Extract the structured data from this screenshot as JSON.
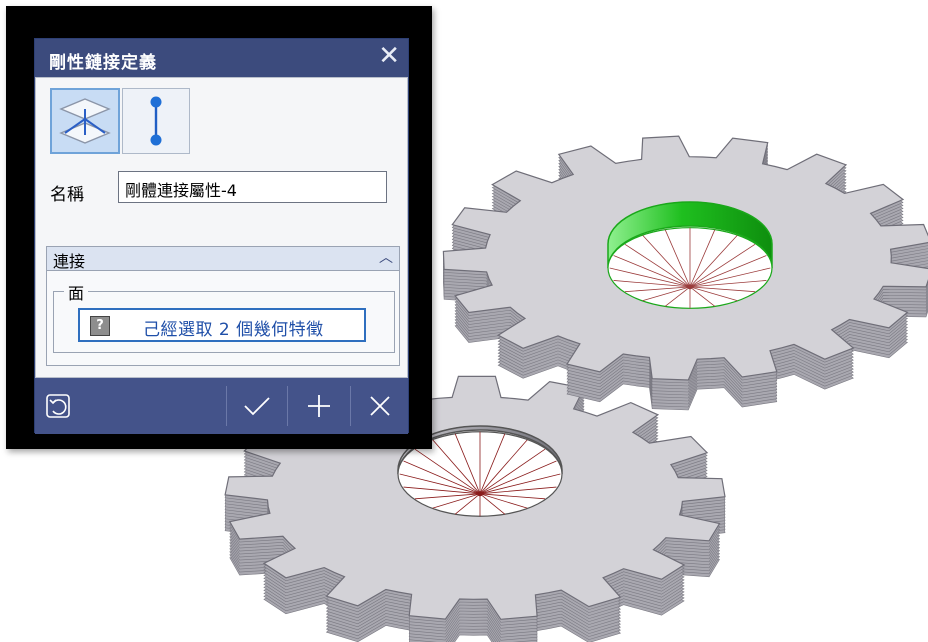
{
  "dialog": {
    "title": "剛性鏈接定義",
    "close_icon": "close-icon",
    "type_buttons": [
      {
        "icon": "plane-connection-icon",
        "selected": true
      },
      {
        "icon": "line-connection-icon",
        "selected": false
      }
    ],
    "name_label": "名稱",
    "name_value": "剛體連接屬性-4",
    "section": {
      "title": "連接",
      "collapse_icon": "chevron-up-icon",
      "group_legend": "面",
      "selection_text": "己經選取 2 個幾何特徵",
      "status_icon": "question-icon"
    },
    "footer": {
      "reset_icon": "reset-icon",
      "ok_icon": "check-icon",
      "add_icon": "plus-icon",
      "cancel_icon": "x-icon"
    }
  },
  "colors": {
    "title_bar": "#3c4b7d",
    "footer": "#44538a",
    "selected_face": "#22c422",
    "gear_top": "#d3d2d7",
    "gear_side": "#a9a8b0"
  }
}
